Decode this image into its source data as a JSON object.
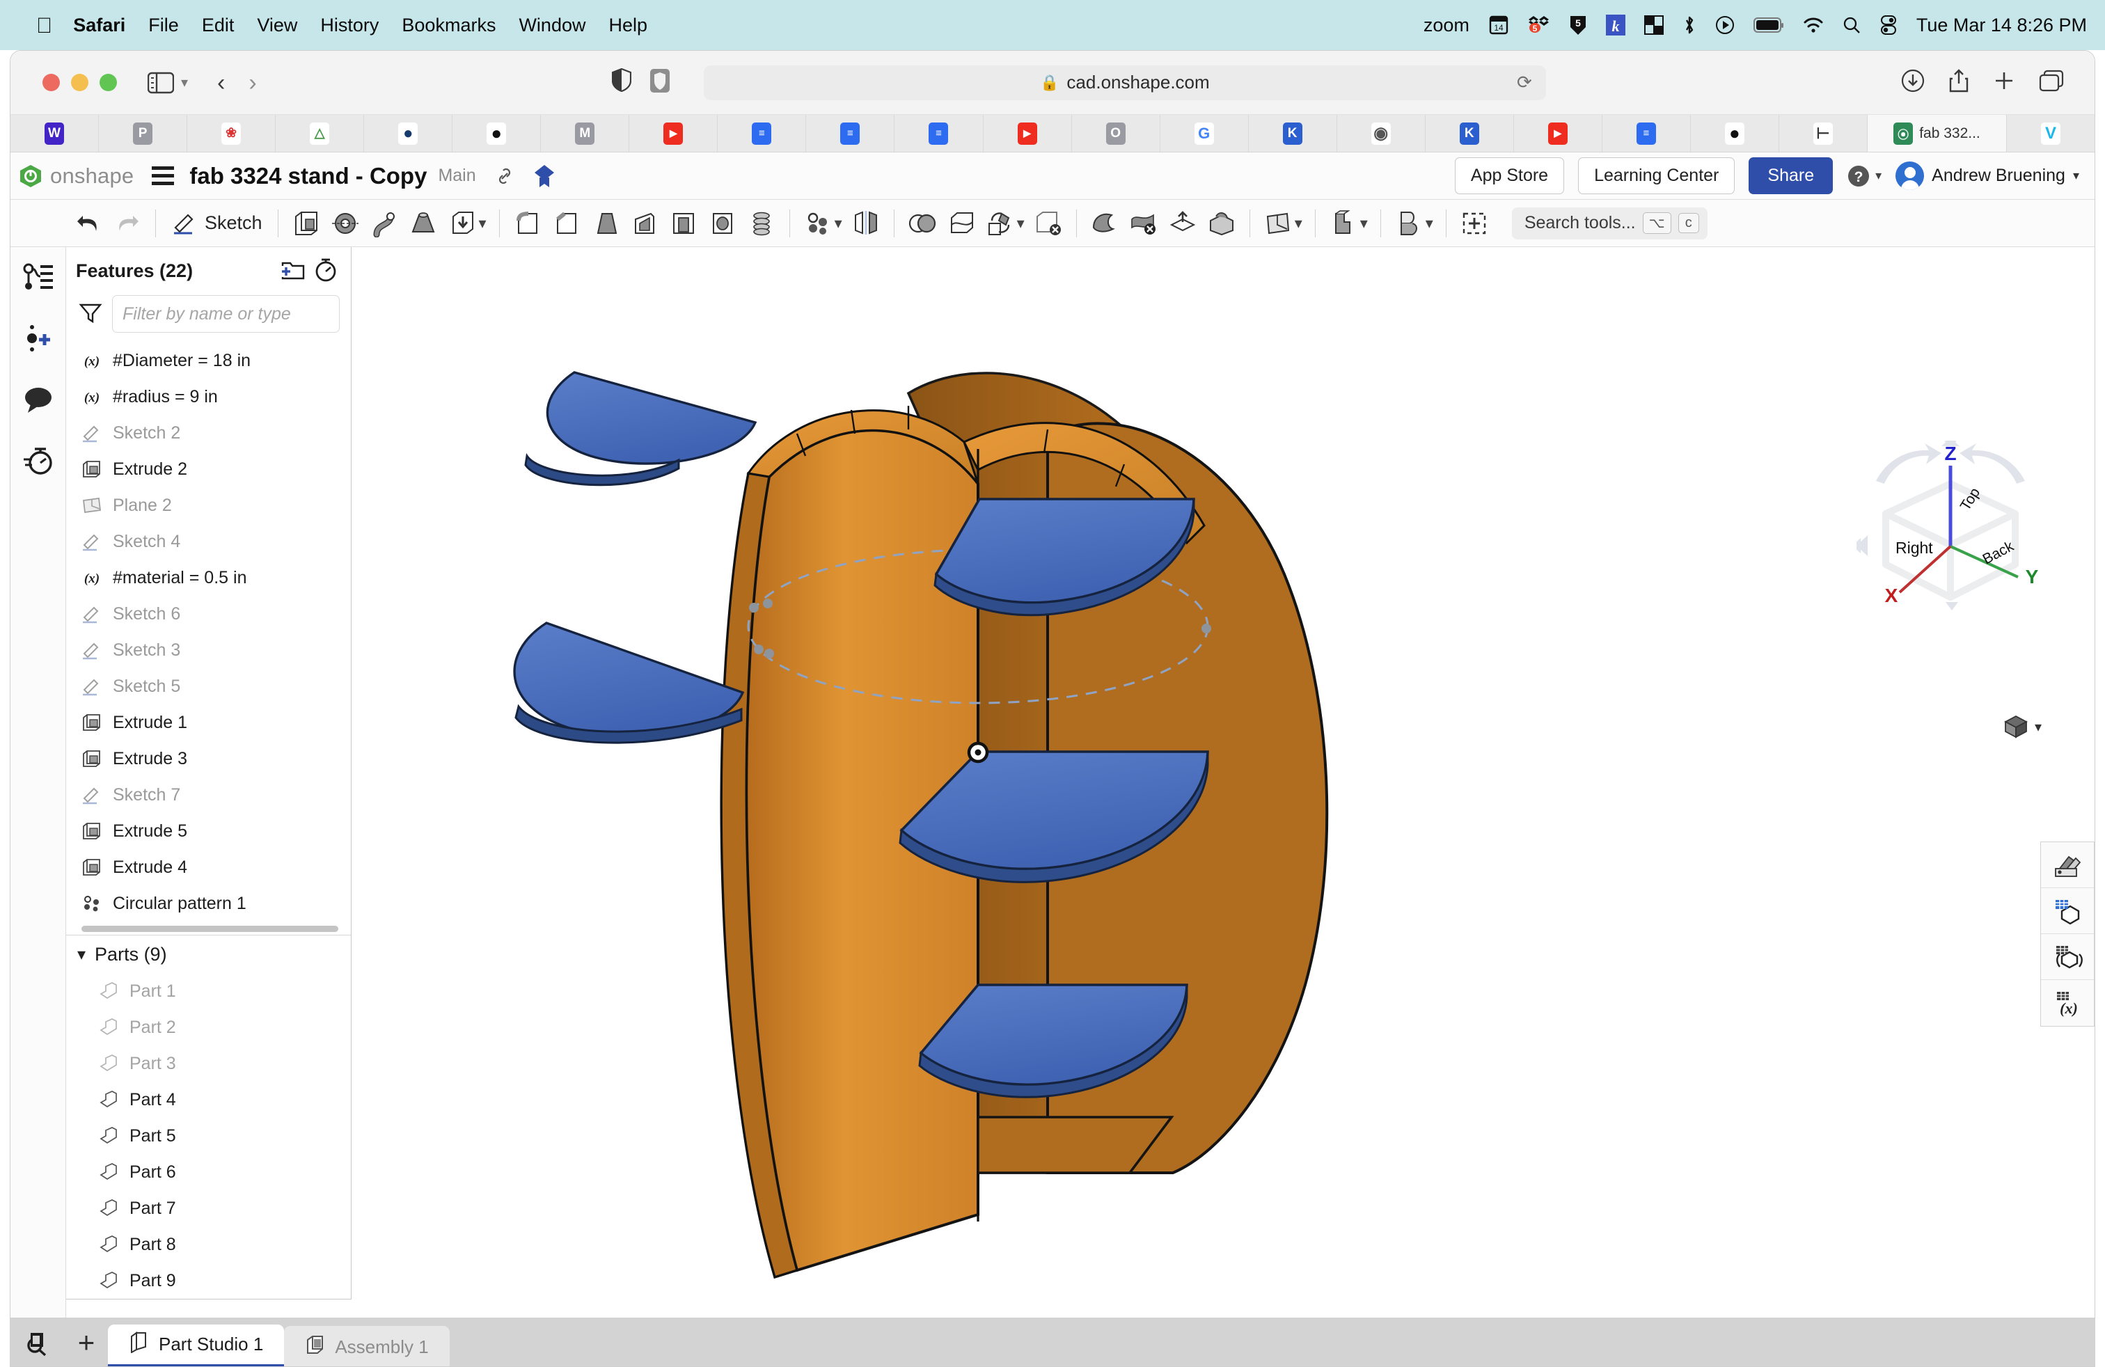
{
  "macbar": {
    "apple_glyph": "",
    "menus": [
      {
        "label": "Safari",
        "bold": true
      },
      {
        "label": "File",
        "bold": false
      },
      {
        "label": "Edit",
        "bold": false
      },
      {
        "label": "View",
        "bold": false
      },
      {
        "label": "History",
        "bold": false
      },
      {
        "label": "Bookmarks",
        "bold": false
      },
      {
        "label": "Window",
        "bold": false
      },
      {
        "label": "Help",
        "bold": false
      }
    ],
    "status": {
      "zoom_label": "zoom",
      "calendar_day": "14",
      "dropbox_badge": "5",
      "datetime": "Tue Mar 14  8:26 PM"
    }
  },
  "safari": {
    "url": "cad.onshape.com",
    "lock_icon": "lock-icon",
    "reload_icon": "reload-icon",
    "favicons": [
      "webex-icon",
      "p-icon",
      "flower-icon",
      "tree-icon",
      "owl-icon",
      "github-icon",
      "m-icon",
      "youtube-icon",
      "doc-icon",
      "doc-icon",
      "doc-icon",
      "youtube-icon",
      "o-icon",
      "google-icon",
      "k-icon",
      "compass-icon",
      "k-icon",
      "youtube-icon",
      "doc-icon",
      "github-icon",
      "git-icon"
    ],
    "active_tab": {
      "label": "fab 332...",
      "icon": "onshape-icon"
    },
    "trailing_favicon": "vimeo-icon"
  },
  "onshape": {
    "brand": "onshape",
    "doc_title": "fab 3324 stand - Copy",
    "branch": "Main",
    "link_icon": "link-icon",
    "badge_icon": "onshape-badge-icon",
    "app_store": "App Store",
    "learning_center": "Learning Center",
    "share": "Share",
    "help_icon": "help-icon",
    "user_name": "Andrew Bruening"
  },
  "ribbon": {
    "undo_icon": "undo-icon",
    "redo_icon": "redo-icon",
    "sketch_label": "Sketch",
    "tools": [
      "extrude-icon",
      "revolve-icon",
      "sweep-icon",
      "loft-icon",
      "thicken-icon",
      "fillet-icon",
      "chamfer-icon",
      "draft-icon",
      "rib-icon",
      "shell-icon",
      "hole-icon",
      "thread-icon",
      "pattern-icon",
      "mirror-icon",
      "boolean-icon",
      "split-icon",
      "transform-icon",
      "delete-part-icon",
      "draft-surface-icon",
      "delete-face-icon",
      "move-face-icon",
      "enclose-icon",
      "plane-icon",
      "sheet-metal-icon",
      "surface-icon",
      "insert-feature-icon"
    ],
    "search_placeholder": "Search tools...",
    "shortcut_keys": [
      "⌥",
      "c"
    ]
  },
  "rail": {
    "items": [
      "feature-list-icon",
      "add-version-icon",
      "comments-icon",
      "history-icon"
    ]
  },
  "tree": {
    "title": "Features (22)",
    "new_folder_icon": "new-folder-icon",
    "rollback_icon": "rollback-timer-icon",
    "filter_icon": "filter-icon",
    "filter_placeholder": "Filter by name or type",
    "features": [
      {
        "label": "#Diameter = 18 in",
        "icon": "variable-icon",
        "dim": false
      },
      {
        "label": "#radius = 9 in",
        "icon": "variable-icon",
        "dim": false
      },
      {
        "label": "Sketch 2",
        "icon": "sketch-icon",
        "dim": true
      },
      {
        "label": "Extrude 2",
        "icon": "extrude-icon",
        "dim": false
      },
      {
        "label": "Plane 2",
        "icon": "plane-icon",
        "dim": true
      },
      {
        "label": "Sketch 4",
        "icon": "sketch-icon",
        "dim": true
      },
      {
        "label": "#material = 0.5 in",
        "icon": "variable-icon",
        "dim": false
      },
      {
        "label": "Sketch 6",
        "icon": "sketch-icon",
        "dim": true
      },
      {
        "label": "Sketch 3",
        "icon": "sketch-icon",
        "dim": true
      },
      {
        "label": "Sketch 5",
        "icon": "sketch-icon",
        "dim": true
      },
      {
        "label": "Extrude 1",
        "icon": "extrude-icon",
        "dim": false
      },
      {
        "label": "Extrude 3",
        "icon": "extrude-icon",
        "dim": false
      },
      {
        "label": "Sketch 7",
        "icon": "sketch-icon",
        "dim": true
      },
      {
        "label": "Extrude 5",
        "icon": "extrude-icon",
        "dim": false
      },
      {
        "label": "Extrude 4",
        "icon": "extrude-icon",
        "dim": false
      },
      {
        "label": "Circular pattern 1",
        "icon": "circular-pattern-icon",
        "dim": false
      }
    ],
    "parts_title": "Parts (9)",
    "parts": [
      {
        "label": "Part 1",
        "dim": true
      },
      {
        "label": "Part 2",
        "dim": true
      },
      {
        "label": "Part 3",
        "dim": true
      },
      {
        "label": "Part 4",
        "dim": false
      },
      {
        "label": "Part 5",
        "dim": false
      },
      {
        "label": "Part 6",
        "dim": false
      },
      {
        "label": "Part 7",
        "dim": false
      },
      {
        "label": "Part 8",
        "dim": false
      },
      {
        "label": "Part 9",
        "dim": false
      }
    ]
  },
  "viewport": {
    "viewcube": {
      "axis_z": "Z",
      "axis_y": "Y",
      "axis_x": "X",
      "face_top": "Top",
      "face_right": "Right",
      "face_back": "Back"
    },
    "display_mode_icon": "shaded-cube-icon",
    "right_tools": [
      "appearance-icon",
      "render-icon",
      "configuration-icon",
      "variable-studio-icon"
    ],
    "bottom_tools": [
      "measure-icon",
      "mass-properties-icon"
    ],
    "model_colors": {
      "body_light": "#d88a2a",
      "body_dark": "#a8661f",
      "body_mid": "#b8731f",
      "shelf": "#4a6cba",
      "shelf_dark": "#2d4880"
    }
  },
  "tabs": {
    "zoom_icon": "zoom-to-fit-icon",
    "add_label": "+",
    "items": [
      {
        "label": "Part Studio 1",
        "icon": "part-studio-icon",
        "active": true
      },
      {
        "label": "Assembly 1",
        "icon": "assembly-icon",
        "active": false
      }
    ]
  }
}
